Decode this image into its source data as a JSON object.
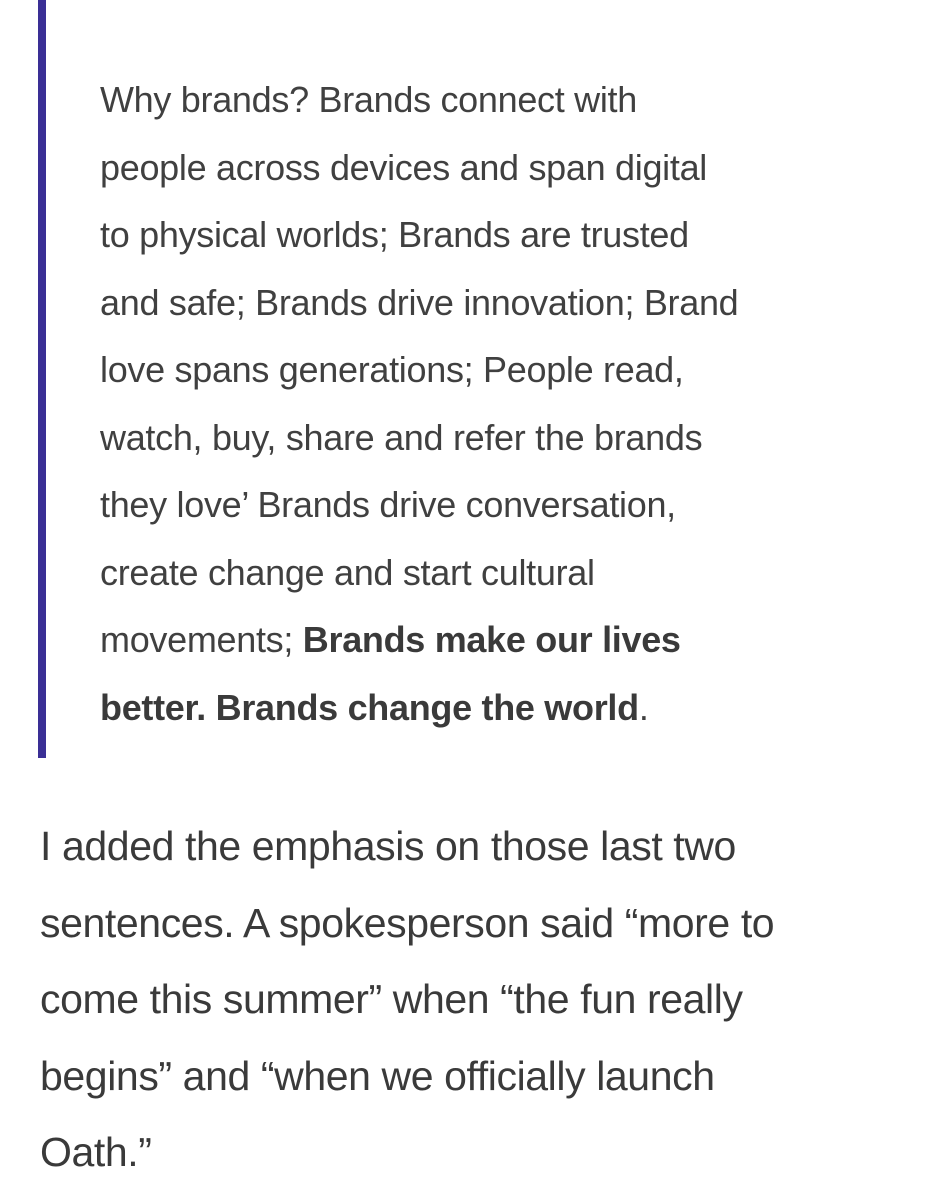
{
  "blockquote": {
    "lines": [
      "Why brands? Brands connect with",
      "people across devices and span digital",
      "to physical worlds; Brands are trusted",
      "and safe; Brands drive innovation; Brand",
      "love spans generations; People read,",
      "watch, buy, share and refer the brands",
      "they love’ Brands drive conversation,",
      "create change and start cultural"
    ],
    "line9_plain": "movements; ",
    "line9_bold": "Brands make our lives",
    "line10_bold": "better. Brands change the world",
    "line10_plain": ".",
    "accent_color": "#3a2f95"
  },
  "paragraph": {
    "lines": [
      "I added the emphasis on those last two",
      "sentences. A spokesperson said “more to",
      "come this summer” when “the fun really",
      "begins” and “when we officially launch",
      "Oath.”"
    ]
  }
}
